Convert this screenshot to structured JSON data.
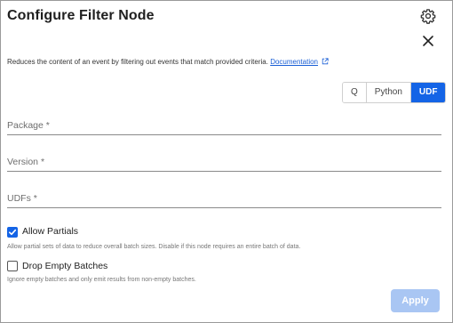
{
  "dialog": {
    "title": "Configure Filter Node",
    "description": "Reduces the content of an event by filtering out events that match provided criteria.",
    "documentation_link": "Documentation"
  },
  "language_toggle": {
    "options": [
      "Q",
      "Python",
      "UDF"
    ],
    "selected": "UDF"
  },
  "fields": {
    "package_label": "Package *",
    "package_value": "",
    "version_label": "Version *",
    "version_value": "",
    "udfs_label": "UDFs *",
    "udfs_value": ""
  },
  "options": {
    "allow_partials_label": "Allow Partials",
    "allow_partials_checked": true,
    "allow_partials_hint": "Allow partial sets of data to reduce overall batch sizes. Disable if this node requires an entire batch of data.",
    "drop_empty_label": "Drop Empty Batches",
    "drop_empty_checked": false,
    "drop_empty_hint": "Ignore empty batches and only emit results from non-empty batches."
  },
  "footer": {
    "apply_label": "Apply",
    "apply_enabled": false
  },
  "colors": {
    "accent": "#1464e6",
    "apply_disabled": "#a9c6f3",
    "link": "#1a5fd6"
  }
}
